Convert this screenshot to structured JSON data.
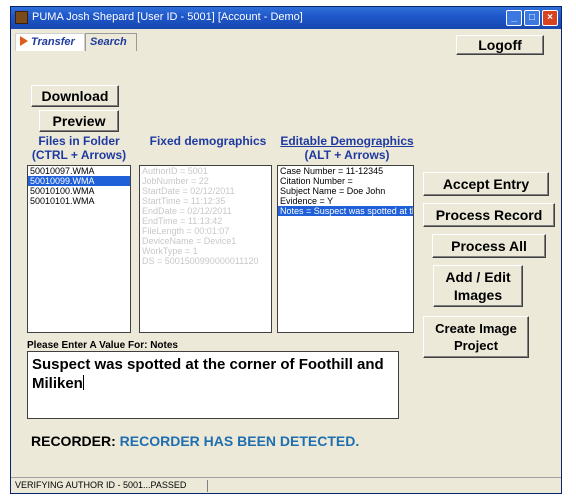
{
  "window": {
    "title": "PUMA  Josh Shepard [User ID - 5001] [Account - Demo]"
  },
  "tabs": [
    {
      "label": "Transfer",
      "active": true
    },
    {
      "label": "Search",
      "active": false
    }
  ],
  "buttons": {
    "logoff": "Logoff",
    "download": "Download",
    "preview": "Preview",
    "accept_entry": "Accept Entry",
    "process_record": "Process Record",
    "process_all": "Process All",
    "add_edit_images": "Add / Edit\nImages",
    "create_image_project": "Create Image\nProject"
  },
  "files_panel": {
    "heading_line1": "Files in Folder",
    "heading_line2": "(CTRL + Arrows)",
    "items": [
      "50010097.WMA",
      "50010099.WMA",
      "50010100.WMA",
      "50010101.WMA"
    ],
    "selected_index": 1
  },
  "fixed_panel": {
    "heading": "Fixed demographics",
    "items": [
      "AuthorID = 5001",
      "JobNumber = 22",
      "StartDate = 02/12/2011",
      "StartTime = 11:12:35",
      "EndDate = 02/12/2011",
      "EndTime = 11:13:42",
      "FileLength = 00:01:07",
      "DeviceName = Device1",
      "WorkType = 1",
      "DS = 5001500990000011120"
    ]
  },
  "editable_panel": {
    "heading_line1": "Editable Demographics",
    "heading_line2": "(ALT + Arrows)",
    "items": [
      "Case Number = 11-12345",
      "Citation Number =",
      "Subject Name = Doe John",
      "Evidence = Y",
      "Notes = Suspect was spotted at the co"
    ],
    "selected_index": 4
  },
  "notes": {
    "prompt": "Please Enter A Value For: Notes",
    "value": "Suspect was spotted at the corner of Foothill and Miliken"
  },
  "recorder": {
    "label": "RECORDER:",
    "status": "RECORDER HAS BEEN DETECTED."
  },
  "status_bar": {
    "text": "VERIFYING AUTHOR ID - 5001...PASSED"
  },
  "colors": {
    "titlebar": "#1e56c8",
    "heading_blue": "#1f3aa0",
    "selection": "#1f5fd8",
    "recorder_status": "#1f6fb0",
    "transfer_arrow": "#e05a1a"
  },
  "icons": {
    "app": "puma-app-icon",
    "transfer_tab": "orange-play-arrow-icon"
  }
}
